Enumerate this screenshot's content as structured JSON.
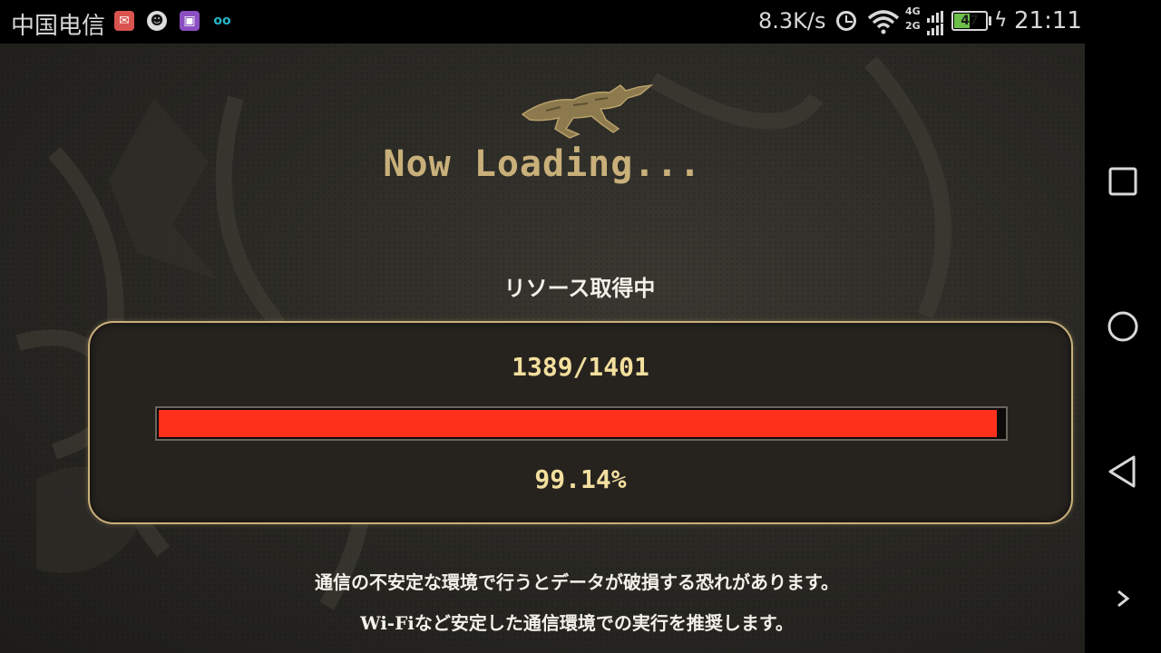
{
  "status_bar": {
    "carrier": "中国电信",
    "notification_icons": [
      "mail-icon",
      "qq-penguin-icon",
      "gallery-icon",
      "voicemail-icon"
    ],
    "net_speed": "8.3K/s",
    "network_types": [
      "4G",
      "2G"
    ],
    "battery_level": "47",
    "battery_percent": 47,
    "charging": true,
    "time": "21:11"
  },
  "game": {
    "logo_icon": "wolf-logo-icon",
    "loading_title": "Now Loading...",
    "resource_label": "リソース取得中",
    "progress": {
      "count_text": "1389/1401",
      "percent_text": "99.14%",
      "fraction": 0.9914,
      "fill_color": "#ff311d"
    },
    "warning_line_1": "通信の不安定な環境で行うとデータが破損する恐れがあります。",
    "warning_line_2": "Wi-Fiなど安定した通信環境での実行を推奨します。"
  },
  "nav_bar": {
    "buttons": [
      "recent-apps",
      "home",
      "back",
      "expand"
    ]
  },
  "colors": {
    "accent_gold": "#c9b07a",
    "progress_red": "#ff311d",
    "battery_green": "#6cc04a"
  }
}
